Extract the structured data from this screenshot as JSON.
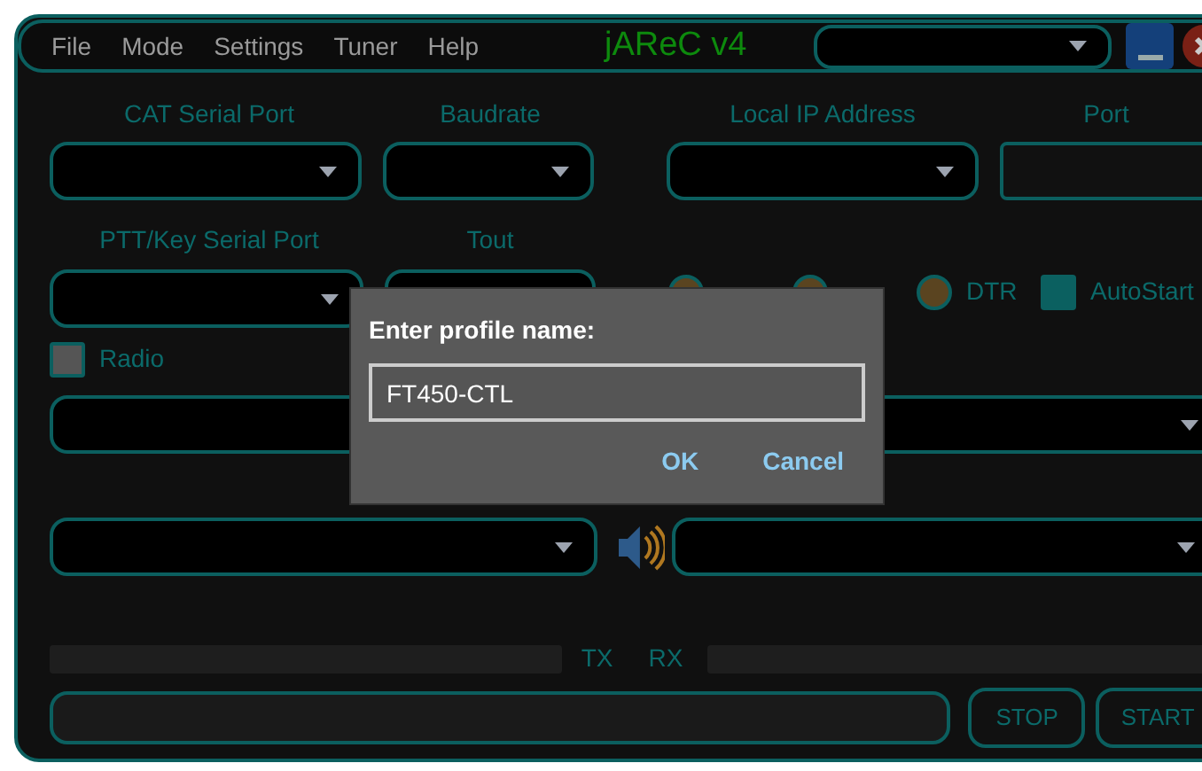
{
  "menu": [
    "File",
    "Mode",
    "Settings",
    "Tuner",
    "Help"
  ],
  "title": "jAReC v4",
  "fields": {
    "cat_port": {
      "label": "CAT Serial Port"
    },
    "baudrate": {
      "label": "Baudrate"
    },
    "local_ip": {
      "label": "Local IP Address"
    },
    "port": {
      "label": "Port"
    },
    "ptt_port": {
      "label": "PTT/Key Serial Port"
    },
    "tout": {
      "label": "Tout"
    }
  },
  "ptt_options": [
    {
      "selected": false
    },
    {
      "selected": false
    },
    {
      "label": "DTR",
      "selected": false
    }
  ],
  "autostart": {
    "label": "AutoStart",
    "checked": true
  },
  "radio": {
    "label": "Radio",
    "checked": false
  },
  "meters": {
    "tx": "TX",
    "rx": "RX"
  },
  "buttons": {
    "stop": "STOP",
    "start": "START"
  },
  "dialog": {
    "title": "Enter profile name:",
    "value": "FT450-CTL",
    "ok": "OK",
    "cancel": "Cancel"
  }
}
